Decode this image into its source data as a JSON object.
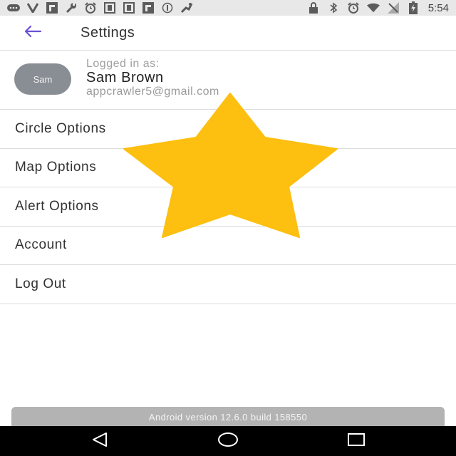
{
  "status_bar": {
    "time": "5:54",
    "left_icons": [
      "chat-icon",
      "v-icon",
      "flipboard-icon",
      "wrench-icon",
      "alarm-icon",
      "doc-icon",
      "doc-icon",
      "flipboard-icon",
      "info-icon",
      "sports-icon"
    ],
    "right_icons": [
      "lock-icon",
      "bluetooth-icon",
      "alarm-icon",
      "wifi-icon",
      "signal-icon",
      "battery-icon"
    ]
  },
  "app_bar": {
    "title": "Settings",
    "back_icon": "arrow-left-icon",
    "accent_color": "#6a4fd6"
  },
  "profile": {
    "avatar_text": "Sam",
    "logged_in_label": "Logged in as:",
    "name": "Sam Brown",
    "email": "appcrawler5@gmail.com"
  },
  "menu": {
    "items": [
      {
        "label": "Circle Options"
      },
      {
        "label": "Map Options"
      },
      {
        "label": "Alert Options"
      },
      {
        "label": "Account"
      },
      {
        "label": "Log Out"
      }
    ]
  },
  "footer": {
    "version": "Android version 12.6.0 build 158550"
  },
  "nav_bar": {
    "icons": [
      "back-triangle-icon",
      "home-circle-icon",
      "recents-square-icon"
    ]
  },
  "overlay": {
    "icon": "star-icon",
    "color": "#fdbf10"
  }
}
